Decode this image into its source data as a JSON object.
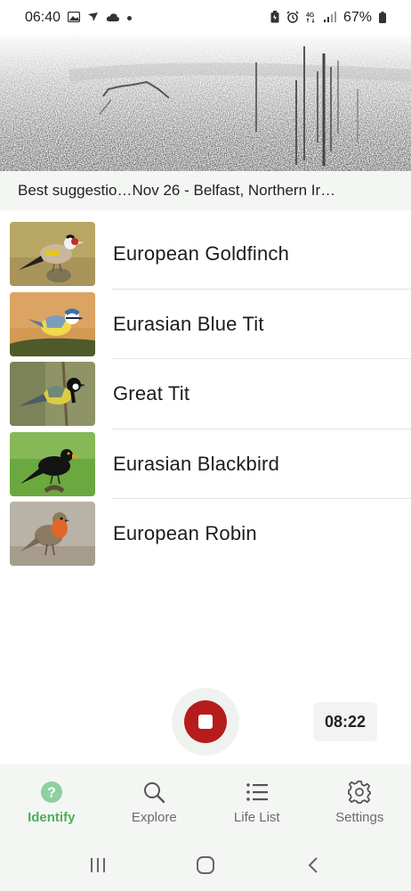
{
  "status_bar": {
    "time": "06:40",
    "battery": "67%",
    "left_icons": [
      "gallery-icon",
      "arrow-icon",
      "cloud-icon",
      "dot-icon"
    ],
    "right_icons": [
      "battery-saver-icon",
      "alarm-icon",
      "4g-icon",
      "signal-icon",
      "battery-icon"
    ]
  },
  "suggestion": {
    "label": "Best suggestio…",
    "location": "Nov 26 - Belfast, Northern Ir…"
  },
  "species": [
    {
      "name": "European Goldfinch"
    },
    {
      "name": "Eurasian Blue Tit"
    },
    {
      "name": "Great Tit"
    },
    {
      "name": "Eurasian Blackbird"
    },
    {
      "name": "European Robin"
    }
  ],
  "recorder": {
    "timer": "08:22",
    "button_color": "#b71c1c"
  },
  "bottom_nav": {
    "items": [
      {
        "label": "Identify",
        "icon": "question-icon",
        "active": true
      },
      {
        "label": "Explore",
        "icon": "search-icon",
        "active": false
      },
      {
        "label": "Life List",
        "icon": "list-icon",
        "active": false
      },
      {
        "label": "Settings",
        "icon": "gear-icon",
        "active": false
      }
    ],
    "active_color": "#4caf5c"
  },
  "system_nav": {
    "buttons": [
      "recents-icon",
      "home-icon",
      "back-icon"
    ]
  }
}
